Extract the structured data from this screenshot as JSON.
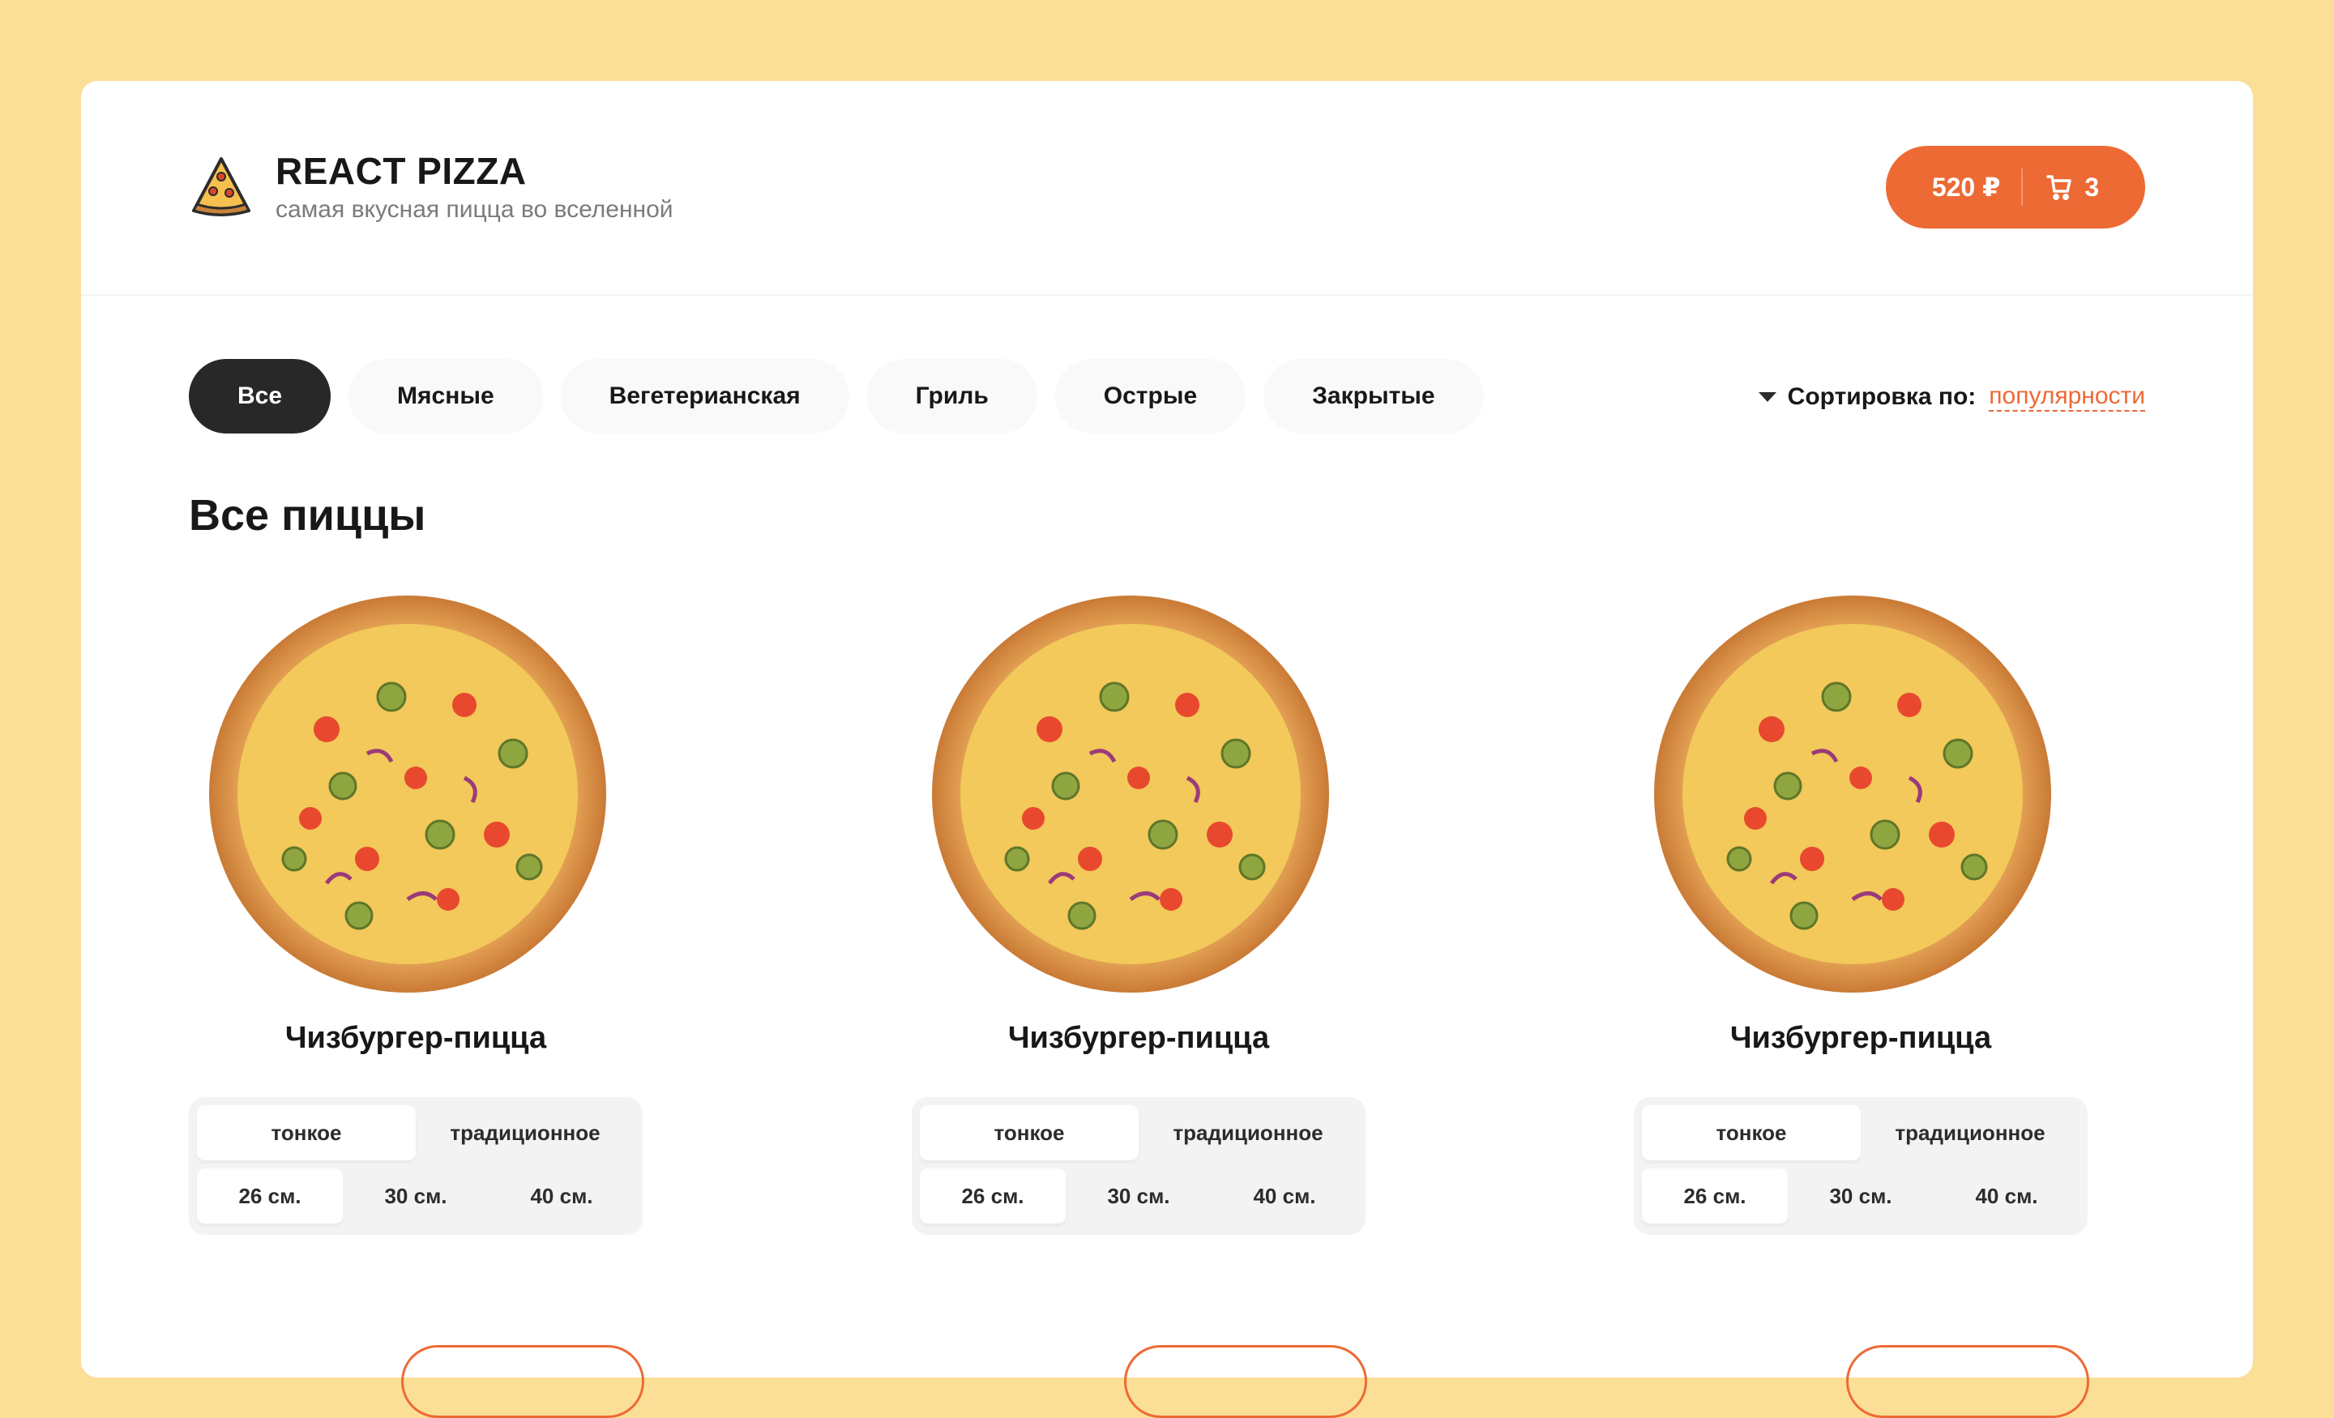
{
  "header": {
    "logo_icon": "pizza-slice-icon",
    "title": "REACT PIZZA",
    "subtitle": "самая вкусная пицца во вселенной",
    "cart": {
      "price": "520 ₽",
      "count": "3",
      "icon": "cart-icon"
    }
  },
  "categories": [
    "Все",
    "Мясные",
    "Вегетерианская",
    "Гриль",
    "Острые",
    "Закрытые"
  ],
  "active_category": 0,
  "sort": {
    "label": "Сортировка по:",
    "value": "популярности"
  },
  "section_title": "Все пиццы",
  "pizzas": [
    {
      "title": "Чизбургер-пицца",
      "types": [
        "тонкое",
        "традиционное"
      ],
      "sizes": [
        "26 см.",
        "30 см.",
        "40 см."
      ]
    },
    {
      "title": "Чизбургер-пицца",
      "types": [
        "тонкое",
        "традиционное"
      ],
      "sizes": [
        "26 см.",
        "30 см.",
        "40 см."
      ]
    },
    {
      "title": "Чизбургер-пицца",
      "types": [
        "тонкое",
        "традиционное"
      ],
      "sizes": [
        "26 см.",
        "30 см.",
        "40 см."
      ]
    }
  ],
  "colors": {
    "accent": "#ed6a34",
    "background": "#fcdf97",
    "dark": "#282828"
  }
}
